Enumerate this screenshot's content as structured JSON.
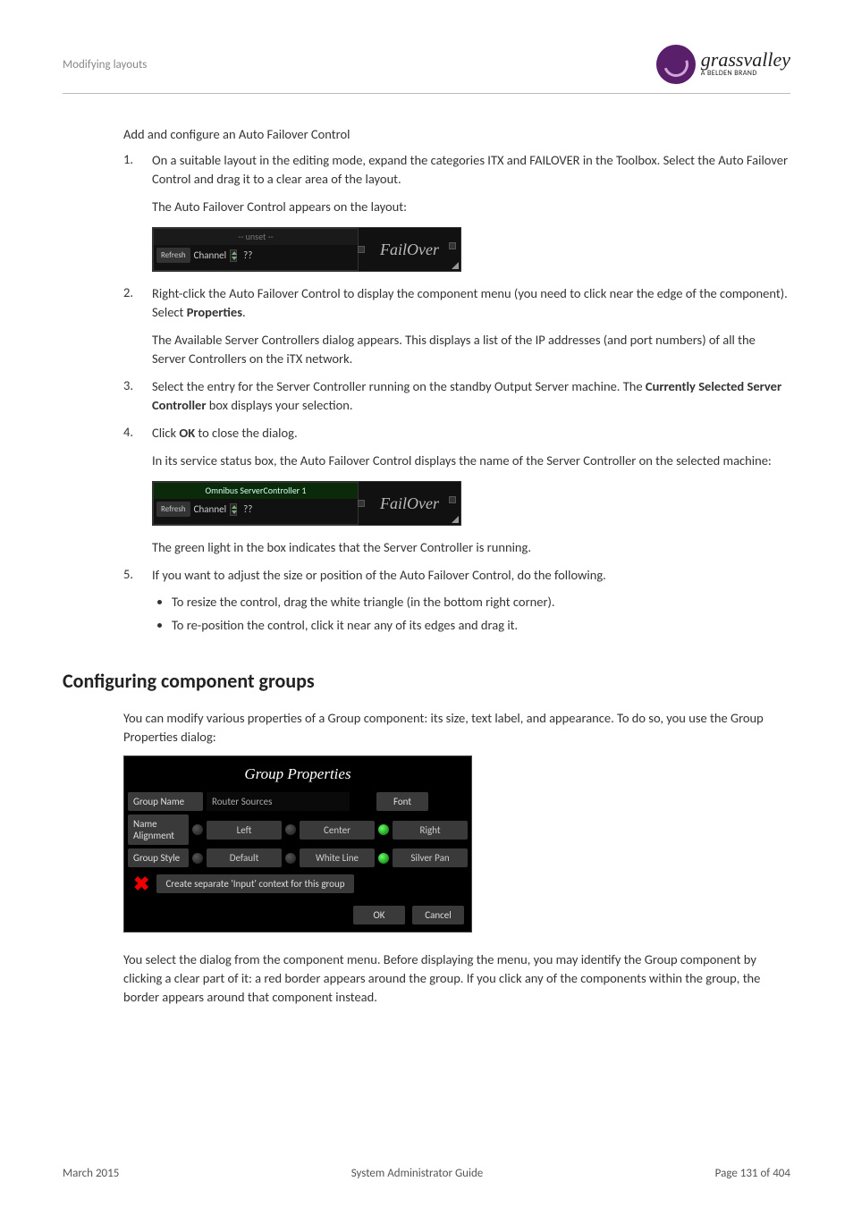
{
  "header": {
    "section": "Modifying layouts"
  },
  "logo": {
    "main": "grassvalley",
    "sub": "A BELDEN BRAND"
  },
  "intro": {
    "title": "Add and configure an Auto Failover Control"
  },
  "steps": {
    "s1": {
      "p1": "On a suitable layout in the editing mode, expand the categories ITX and FAILOVER in the Toolbox. Select the Auto Failover Control and drag it to a clear area of the layout.",
      "p2": "The Auto Failover Control appears on the layout:"
    },
    "s2": {
      "p1a": "Right-click the Auto Failover Control to display the component menu (you need to click near the edge of the component). Select ",
      "p1b": "Properties",
      "p1c": ".",
      "p2": "The Available Server Controllers dialog appears. This displays a list of the IP addresses (and port numbers) of all the Server Controllers on the iTX network."
    },
    "s3": {
      "p1a": "Select the entry for the Server Controller running on the standby Output Server machine. The ",
      "p1b": "Currently Selected Server Controller",
      "p1c": " box displays your selection."
    },
    "s4": {
      "p1a": "Click ",
      "p1b": "OK",
      "p1c": " to close the dialog.",
      "p2": "In its service status box, the Auto Failover Control displays the name of the Server Controller on the selected machine:",
      "p3": "The green light in the box indicates that the Server Controller is running."
    },
    "s5": {
      "p1": "If you want to adjust the size or position of the Auto Failover Control, do the following.",
      "b1": "To resize the control, drag the white triangle (in the bottom right corner).",
      "b2": "To re-position the control, click it near any of its edges and drag it."
    }
  },
  "failover1": {
    "top": "-- unset --",
    "refresh": "Refresh",
    "channel": "Channel",
    "qq": "??",
    "label": "FailOver"
  },
  "failover2": {
    "top": "Omnibus ServerController 1",
    "refresh": "Refresh",
    "channel": "Channel",
    "qq": "??",
    "label": "FailOver"
  },
  "section2": {
    "title": "Configuring component groups",
    "intro": "You can modify various properties of a Group component: its size, text label, and appearance. To do so, you use the Group Properties dialog:",
    "outro": "You select the dialog from the component menu. Before displaying the menu, you may identify the Group component by clicking a clear part of it: a red border appears around the group. If you click any of the components within the group, the border appears around that component instead."
  },
  "gp": {
    "title": "Group Properties",
    "name_label": "Group Name",
    "name_value": "Router Sources",
    "font_btn": "Font",
    "align_label": "Name Alignment",
    "left": "Left",
    "center": "Center",
    "right": "Right",
    "style_label": "Group Style",
    "default": "Default",
    "white": "White Line",
    "silver": "Silver Pan",
    "check": "Create separate 'Input' context for this group",
    "ok": "OK",
    "cancel": "Cancel"
  },
  "footer": {
    "left": "March 2015",
    "center": "System Administrator Guide",
    "right": "Page 131 of 404"
  }
}
